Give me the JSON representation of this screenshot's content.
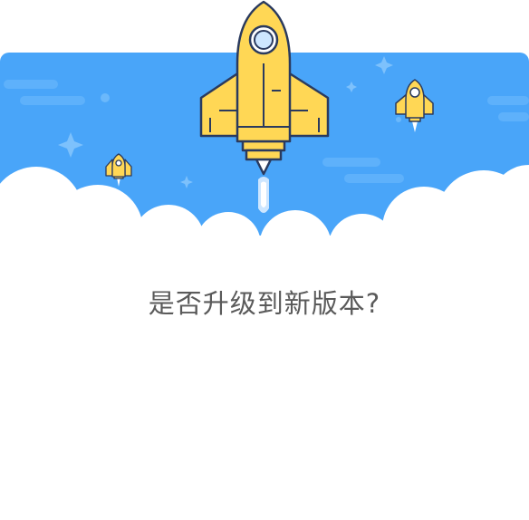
{
  "dialog": {
    "message": "是否升级到新版本?"
  },
  "colors": {
    "banner_blue": "#49a5f9",
    "rocket_yellow": "#ffd755",
    "outline": "#2a3a5e",
    "cloud": "#ffffff",
    "text": "#5a5a5a"
  },
  "icons": {
    "main": "rocket-icon",
    "small_left": "small-rocket-icon",
    "small_right": "small-rocket-icon",
    "stars": "sparkle-star-icon",
    "clouds": "cloud-icon"
  }
}
